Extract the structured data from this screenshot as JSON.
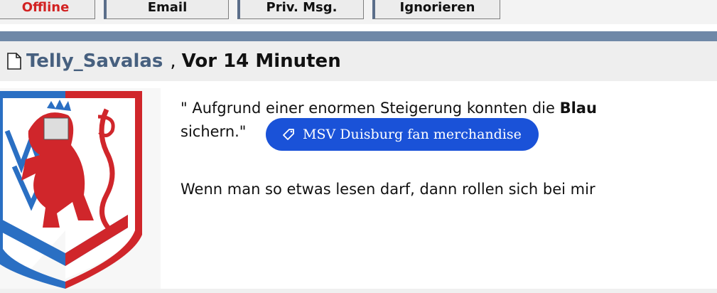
{
  "toolbar": {
    "buttons": [
      "Offline",
      "Email",
      "Priv. Msg.",
      "Ignorieren"
    ]
  },
  "post": {
    "username": "Telly_Savalas",
    "separator": ",",
    "time": "Vor 14 Minuten",
    "line1_prefix": "\" Aufgrund einer enormen Steigerung konnten die ",
    "line1_bold": "Blau",
    "line2": "sichern.\"",
    "line3": "Wenn man so etwas lesen darf, dann rollen sich bei mir"
  },
  "tag": {
    "label": "MSV Duisburg fan merchandise",
    "icon": "tag-icon"
  },
  "colors": {
    "accent_bar": "#6f88a7",
    "username": "#47607f",
    "offline": "#d22222",
    "tag_bg": "#1a52d8"
  }
}
